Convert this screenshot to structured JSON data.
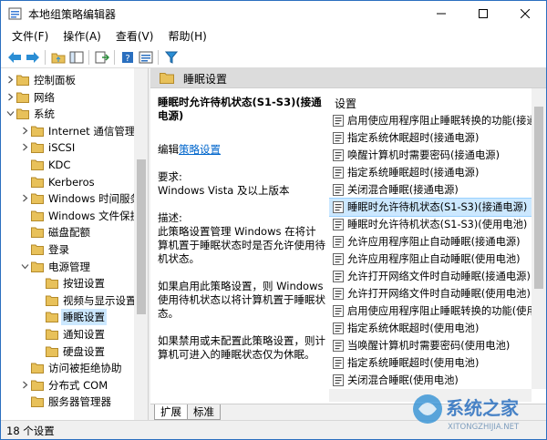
{
  "window": {
    "title": "本地组策略编辑器"
  },
  "menu": [
    "文件(F)",
    "操作(A)",
    "查看(V)",
    "帮助(H)"
  ],
  "tree": [
    {
      "label": "控制面板",
      "level": 1,
      "expanded": false
    },
    {
      "label": "网络",
      "level": 1,
      "expanded": false
    },
    {
      "label": "系统",
      "level": 1,
      "expanded": true
    },
    {
      "label": "Internet 通信管理",
      "level": 2,
      "expanded": false
    },
    {
      "label": "iSCSI",
      "level": 2,
      "expanded": false
    },
    {
      "label": "KDC",
      "level": 2,
      "expanded": null
    },
    {
      "label": "Kerberos",
      "level": 2,
      "expanded": null
    },
    {
      "label": "Windows 时间服务",
      "level": 2,
      "expanded": false
    },
    {
      "label": "Windows 文件保护",
      "level": 2,
      "expanded": null
    },
    {
      "label": "磁盘配额",
      "level": 2,
      "expanded": null
    },
    {
      "label": "登录",
      "level": 2,
      "expanded": null
    },
    {
      "label": "电源管理",
      "level": 2,
      "expanded": true
    },
    {
      "label": "按钮设置",
      "level": 3,
      "expanded": null
    },
    {
      "label": "视频与显示设置",
      "level": 3,
      "expanded": null
    },
    {
      "label": "睡眠设置",
      "level": 3,
      "expanded": null,
      "selected": true
    },
    {
      "label": "通知设置",
      "level": 3,
      "expanded": null
    },
    {
      "label": "硬盘设置",
      "level": 3,
      "expanded": null
    },
    {
      "label": "访问被拒绝协助",
      "level": 2,
      "expanded": null
    },
    {
      "label": "分布式 COM",
      "level": 2,
      "expanded": false
    },
    {
      "label": "服务器管理器",
      "level": 2,
      "expanded": null
    }
  ],
  "right_header": "睡眠设置",
  "description": {
    "policy_name": "睡眠时允许待机状态(S1-S3)(接通电源)",
    "edit_prefix": "编辑",
    "edit_link": "策略设置",
    "requirements_label": "要求:",
    "requirements_value": "Windows Vista 及以上版本",
    "desc_label": "描述:",
    "desc_text": "此策略设置管理 Windows 在将计算机置于睡眠状态时是否允许使用待机状态。",
    "enabled_text": "如果启用此策略设置，则 Windows 使用待机状态以将计算机置于睡眠状态。",
    "disabled_text": "如果禁用或未配置此策略设置，则计算机可进入的睡眠状态仅为休眠。"
  },
  "list_header": "设置",
  "settings": [
    "启用使应用程序阻止睡眠转换的功能(接通",
    "指定系统休眠超时(接通电源)",
    "唤醒计算机时需要密码(接通电源)",
    "指定系统睡眠超时(接通电源)",
    "关闭混合睡眠(接通电源)",
    "睡眠时允许待机状态(S1-S3)(接通电源)",
    "睡眠时允许待机状态(S1-S3)(使用电池)",
    "允许应用程序阻止自动睡眠(接通电源)",
    "允许应用程序阻止自动睡眠(使用电池)",
    "允许打开网络文件时自动睡眠(接通电源)",
    "允许打开网络文件时自动睡眠(使用电池)",
    "启用使应用程序阻止睡眠转换的功能(使用",
    "指定系统休眠超时(使用电池)",
    "当唤醒计算机时需要密码(使用电池)",
    "指定系统睡眠超时(使用电池)",
    "关闭混合睡眠(使用电池)"
  ],
  "selected_setting_index": 5,
  "tabs": [
    "扩展",
    "标准"
  ],
  "status": "18 个设置",
  "watermark": {
    "brand": "系统之家",
    "url": "XITONGZHIJIA.NET"
  },
  "colors": {
    "accent": "#0078d7",
    "selection": "#cce8ff",
    "folder": "#e8c15a",
    "link": "#0066cc"
  }
}
